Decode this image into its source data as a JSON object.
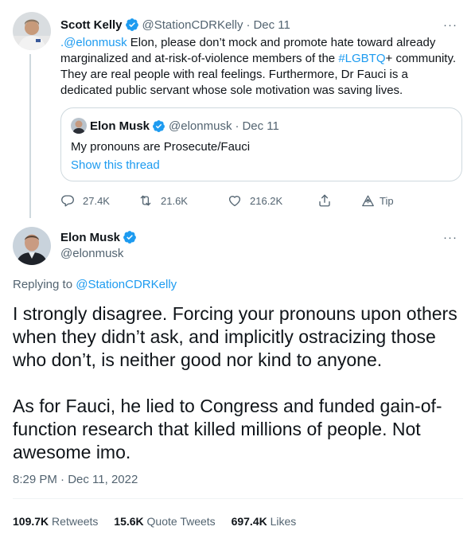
{
  "parent_tweet": {
    "author_name": "Scott Kelly",
    "author_handle": "@StationCDRKelly",
    "date": "Dec 11",
    "text_mention": ".@elonmusk",
    "text_part1": " Elon, please don’t mock and promote hate toward already marginalized and at-risk-of-violence members of the ",
    "text_hashtag": "#LGBTQ",
    "text_part2": "+ community. They are real people with real feelings. Furthermore, Dr Fauci is a dedicated public servant whose sole motivation was saving lives.",
    "quote": {
      "author_name": "Elon Musk",
      "author_handle": "@elonmusk",
      "date": "Dec 11",
      "text": "My pronouns are Prosecute/Fauci",
      "link": "Show this thread"
    },
    "actions": {
      "replies": "27.4K",
      "retweets": "21.6K",
      "likes": "216.2K",
      "tip_label": "Tip"
    }
  },
  "main_tweet": {
    "author_name": "Elon Musk",
    "author_handle": "@elonmusk",
    "replying_prefix": "Replying to ",
    "replying_to": "@StationCDRKelly",
    "text": "I strongly disagree. Forcing your pronouns upon others when they didn’t ask, and implicitly ostracizing those who don’t, is neither good nor kind to anyone.\n\nAs for Fauci, he lied to Congress and funded gain-of-function research that killed millions of people. Not awesome imo.",
    "timestamp": "8:29 PM · Dec 11, 2022",
    "stats": {
      "retweets_count": "109.7K",
      "retweets_label": "Retweets",
      "quotes_count": "15.6K",
      "quotes_label": "Quote Tweets",
      "likes_count": "697.4K",
      "likes_label": "Likes"
    }
  },
  "separator_dot": "·",
  "more_glyph": "···",
  "colors": {
    "accent": "#1d9bf0",
    "text": "#0f1419",
    "muted": "#536471",
    "border": "#cfd9de"
  },
  "icons": [
    "verified-badge-icon",
    "reply-icon",
    "retweet-icon",
    "like-icon",
    "share-icon",
    "tip-icon",
    "more-icon"
  ]
}
